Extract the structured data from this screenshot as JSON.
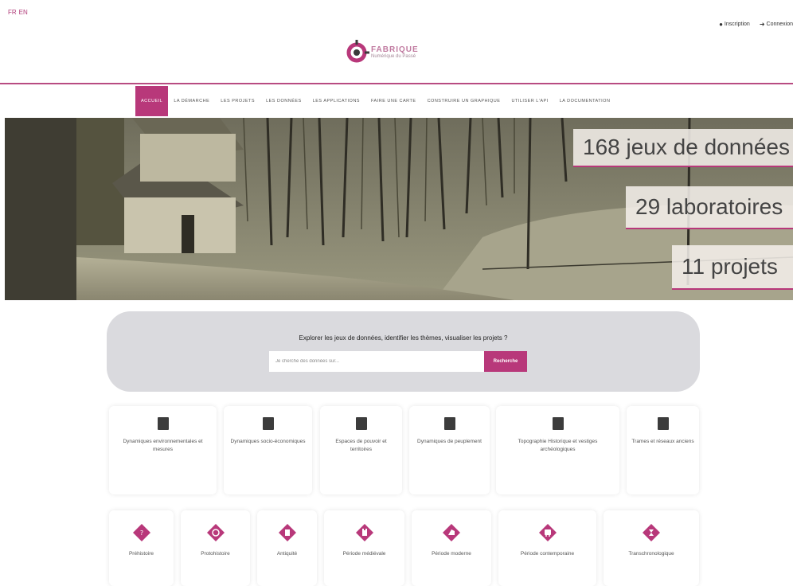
{
  "header": {
    "lang_fr": "FR",
    "lang_en": "EN",
    "signup_label": "Inscription",
    "login_label": "Connexion",
    "logo_line1": "FABRIQUE",
    "logo_line2": "Numérique du Passé"
  },
  "nav": {
    "items": [
      {
        "label": "ACCUEIL",
        "active": true
      },
      {
        "label": "LA DÉMARCHE"
      },
      {
        "label": "LES PROJETS"
      },
      {
        "label": "LES DONNÉES"
      },
      {
        "label": "LES APPLICATIONS"
      },
      {
        "label": "FAIRE UNE CARTE"
      },
      {
        "label": "CONSTRUIRE UN GRAPHIQUE"
      },
      {
        "label": "UTILISER L'API"
      },
      {
        "label": "LA DOCUMENTATION"
      }
    ]
  },
  "hero": {
    "stats": [
      {
        "label": "168 jeux de données"
      },
      {
        "label": "29 laboratoires"
      },
      {
        "label": "11 projets"
      }
    ]
  },
  "search": {
    "title": "Explorer les jeux de données, identifier les thèmes, visualiser les projets ?",
    "placeholder": "Je cherche des données sur...",
    "button_label": "Recherche"
  },
  "themes": [
    {
      "label": "Dynamiques environnementales et mesures",
      "icon": "landscape-icon"
    },
    {
      "label": "Dynamiques socio-économiques",
      "icon": "chart-icon"
    },
    {
      "label": "Espaces de pouvoir et territoires",
      "icon": "territory-icon"
    },
    {
      "label": "Dynamiques de peuplement",
      "icon": "population-icon"
    },
    {
      "label": "Topographie Historique et vestiges archéologiques",
      "icon": "topography-icon"
    },
    {
      "label": "Trames et réseaux anciens",
      "icon": "network-icon"
    }
  ],
  "periods": [
    {
      "label": "Préhistoire",
      "icon": "prehistory-icon"
    },
    {
      "label": "Protohistoire",
      "icon": "protohistory-icon"
    },
    {
      "label": "Antiquité",
      "icon": "antiquity-icon"
    },
    {
      "label": "Période médiévale",
      "icon": "medieval-icon"
    },
    {
      "label": "Période moderne",
      "icon": "modern-icon"
    },
    {
      "label": "Période contemporaine",
      "icon": "contemporary-icon"
    },
    {
      "label": "Transchronologique",
      "icon": "transchronological-icon"
    }
  ],
  "colors": {
    "accent": "#b8387a",
    "search_band": "#dadade",
    "theme_icon": "#3c3c3c"
  }
}
